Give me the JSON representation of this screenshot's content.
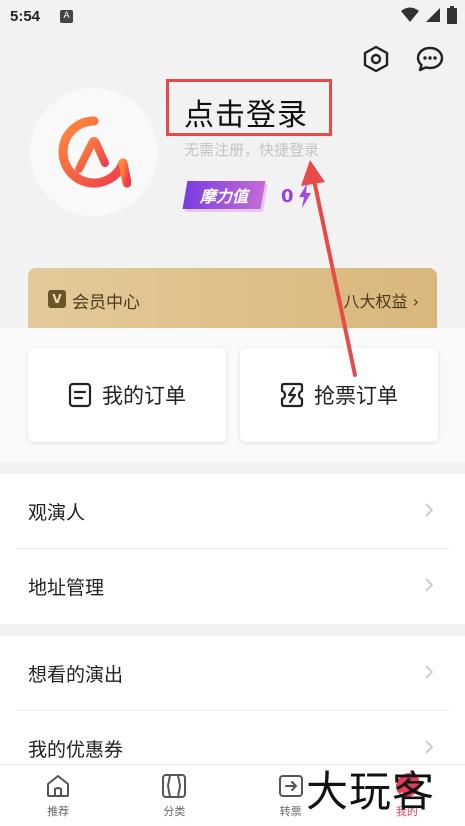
{
  "status_bar": {
    "time": "5:54",
    "notif_icon": "A"
  },
  "header": {
    "settings_icon": "hexagon-gear-icon",
    "message_icon": "chat-bubble-icon"
  },
  "profile": {
    "login_title": "点击登录",
    "login_subtitle": "无需注册，快捷登录",
    "moli_label": "摩力值",
    "moli_value": "0",
    "logo_colors": [
      "#f04e4e",
      "#ff8a3a"
    ]
  },
  "vip": {
    "icon_letter": "V",
    "title": "会员中心",
    "right_text": "八大权益 ›"
  },
  "orders": {
    "my_orders": "我的订单",
    "grab_orders": "抢票订单"
  },
  "list1": [
    {
      "label": "观演人"
    },
    {
      "label": "地址管理"
    }
  ],
  "list2": [
    {
      "label": "想看的演出"
    },
    {
      "label": "我的优惠券"
    }
  ],
  "tabs": [
    {
      "label": "推荐",
      "icon": "home-icon"
    },
    {
      "label": "分类",
      "icon": "category-icon"
    },
    {
      "label": "转票",
      "icon": "transfer-icon"
    },
    {
      "label": "我的",
      "icon": "profile-icon"
    }
  ],
  "colors": {
    "accent": "#e83c5c",
    "annotation": "#e84a4a",
    "vip_gold": "#d9b77c"
  },
  "watermark": "大玩客"
}
